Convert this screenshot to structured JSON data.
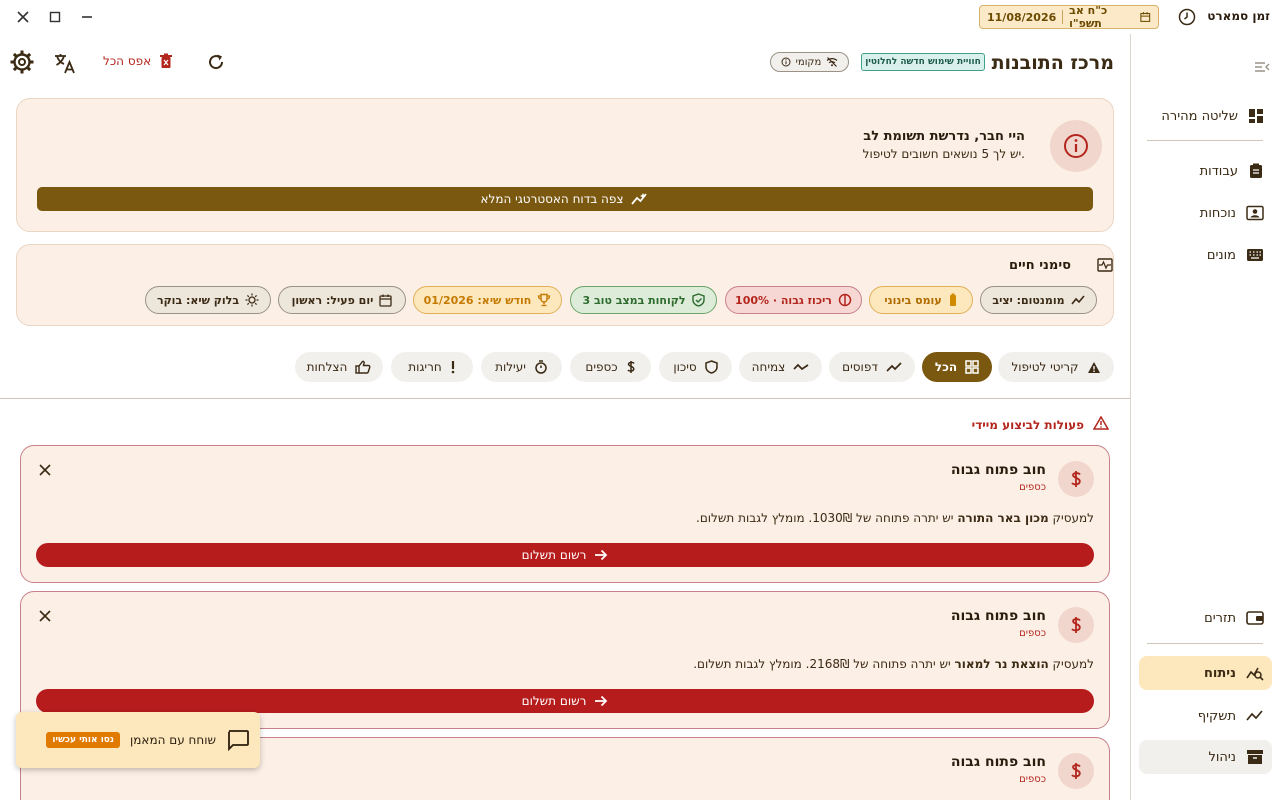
{
  "app": {
    "name": "זמן סמארט",
    "date_greg": "11/08/2026",
    "date_heb": "כ\"ח אב תשפ\"ו"
  },
  "sidebar": {
    "items": [
      {
        "label": "שליטה מהירה",
        "icon": "dashboard-icon"
      },
      {
        "label": "עבודות",
        "icon": "clipboard-icon"
      },
      {
        "label": "נוכחות",
        "icon": "contact-card-icon"
      },
      {
        "label": "מונים",
        "icon": "keyboard-icon"
      },
      {
        "label": "תזרים",
        "icon": "wallet-icon"
      },
      {
        "label": "ניתוח",
        "icon": "analytics-icon"
      },
      {
        "label": "תשקיף",
        "icon": "trend-icon"
      },
      {
        "label": "ניהול",
        "icon": "archive-icon"
      }
    ]
  },
  "header": {
    "title": "מרכז התובנות",
    "beta_badge": "חוויית שימוש חדשה לחלוטין",
    "local_chip": "מקומי",
    "reset_all": "אפס הכל"
  },
  "alert": {
    "title": "היי חבר, נדרשת תשומת לב",
    "subtitle": "יש לך 5 נושאים חשובים לטיפול.",
    "button": "צפה בדוח האסטרטגי המלא"
  },
  "vitals": {
    "title": "סימני חיים",
    "chips": [
      {
        "label": "מומנטום: יציב",
        "icon": "trend-icon"
      },
      {
        "label": "עומס בינוני",
        "icon": "battery-icon"
      },
      {
        "label": "ריכוז גבוה · 100%",
        "icon": "concentration-icon"
      },
      {
        "label": "3 לקוחות במצב טוב",
        "icon": "shield-check-icon"
      },
      {
        "label": "חודש שיא: 01/2026",
        "icon": "trophy-icon"
      },
      {
        "label": "יום פעיל: ראשון",
        "icon": "calendar-icon"
      },
      {
        "label": "בלוק שיא: בוקר",
        "icon": "sun-icon"
      }
    ]
  },
  "filters": [
    {
      "label": "קריטי לטיפול",
      "icon": "warning-icon"
    },
    {
      "label": "הכל",
      "icon": "grid-icon"
    },
    {
      "label": "דפוסים",
      "icon": "trend-icon"
    },
    {
      "label": "צמיחה",
      "icon": "growth-icon"
    },
    {
      "label": "סיכון",
      "icon": "shield-icon"
    },
    {
      "label": "כספים",
      "icon": "dollar-icon"
    },
    {
      "label": "יעילות",
      "icon": "timer-icon"
    },
    {
      "label": "חריגות",
      "icon": "exclamation-icon"
    },
    {
      "label": "הצלחות",
      "icon": "thumbs-up-icon"
    }
  ],
  "section": {
    "title": "פעולות לביצוע מיידי"
  },
  "actions": [
    {
      "title": "חוב פתוח גבוה",
      "category": "כספים",
      "desc_prefix": "למעסיק",
      "desc_name": "מכון באר התורה",
      "desc_suffix": "יש יתרה פתוחה של 1030₪. מומלץ לגבות תשלום.",
      "button": "רשום תשלום"
    },
    {
      "title": "חוב פתוח גבוה",
      "category": "כספים",
      "desc_prefix": "למעסיק",
      "desc_name": "הוצאת נר למאור",
      "desc_suffix": "יש יתרה פתוחה של 2168₪. מומלץ לגבות תשלום.",
      "button": "רשום תשלום"
    },
    {
      "title": "חוב פתוח גבוה",
      "category": "כספים"
    }
  ],
  "chat": {
    "label": "שוחח עם המאמן",
    "badge": "נסו אותי עכשיו"
  },
  "colors": {
    "brand": "#7a5810",
    "danger": "#b71c1c",
    "card_bg": "#fcefe5",
    "active_nav": "#fde7bd"
  }
}
